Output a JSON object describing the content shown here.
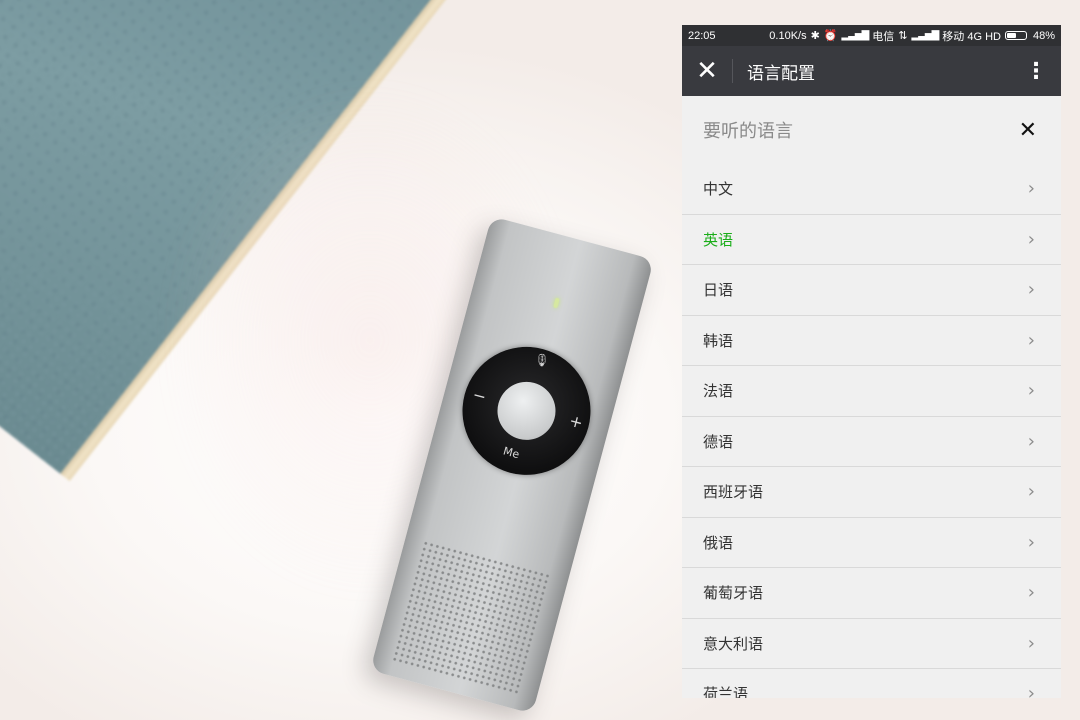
{
  "status_bar": {
    "time": "22:05",
    "net_speed": "0.10K/s",
    "carrier1": "电信",
    "carrier2": "移动 4G HD",
    "battery": "48%",
    "battery_level": 0.48
  },
  "app_bar": {
    "title": "语言配置",
    "close_icon": "close-icon",
    "more_icon": "more-vertical-icon"
  },
  "section": {
    "title": "要听的语言",
    "close_icon": "close-icon"
  },
  "languages": [
    {
      "label": "中文"
    },
    {
      "label": "英语",
      "active": true
    },
    {
      "label": "日语"
    },
    {
      "label": "韩语"
    },
    {
      "label": "法语"
    },
    {
      "label": "德语"
    },
    {
      "label": "西班牙语"
    },
    {
      "label": "俄语"
    },
    {
      "label": "葡萄牙语"
    },
    {
      "label": "意大利语"
    },
    {
      "label": "荷兰语"
    }
  ],
  "colors": {
    "active": "#1aad19",
    "app_bar": "#393a3f",
    "status_bar": "#2f3033"
  },
  "device": {
    "button_labels": [
      "−",
      "+",
      "Me"
    ],
    "mic_icon": "microphone-icon"
  }
}
